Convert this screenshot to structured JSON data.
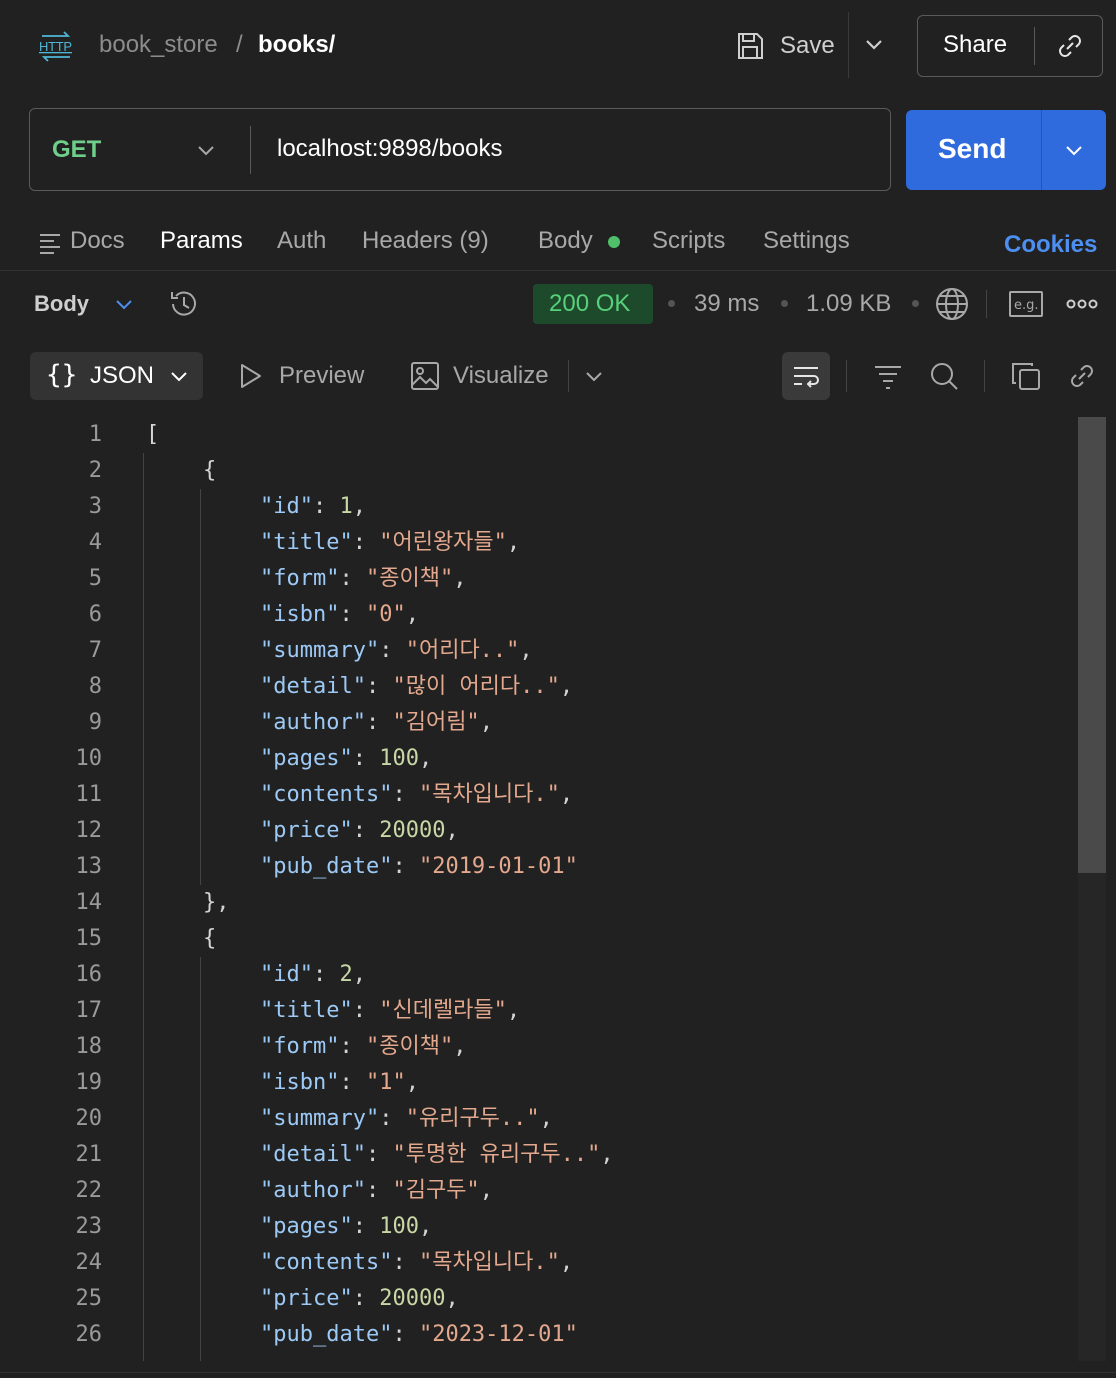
{
  "header": {
    "breadcrumb_parent": "book_store",
    "breadcrumb_separator": "/",
    "breadcrumb_current": "books/",
    "save_label": "Save",
    "share_label": "Share"
  },
  "request": {
    "method": "GET",
    "url": "localhost:9898/books",
    "send_label": "Send"
  },
  "tabs": {
    "docs": "Docs",
    "params": "Params",
    "auth": "Auth",
    "headers": "Headers (9)",
    "body": "Body",
    "scripts": "Scripts",
    "settings": "Settings",
    "cookies": "Cookies",
    "active": "Params"
  },
  "response": {
    "view_label": "Body",
    "status": "200 OK",
    "time": "39 ms",
    "size": "1.09 KB",
    "format_label": "JSON",
    "preview_label": "Preview",
    "visualize_label": "Visualize"
  },
  "colors": {
    "accent_blue": "#2f6bdc",
    "status_green": "#58d07a",
    "method_green": "#6fcf8a",
    "cookies_blue": "#4d8ff0"
  },
  "code_lines": [
    {
      "n": "1",
      "indent": 0,
      "tokens": [
        [
          "p",
          "["
        ]
      ]
    },
    {
      "n": "2",
      "indent": 1,
      "tokens": [
        [
          "p",
          "{"
        ]
      ]
    },
    {
      "n": "3",
      "indent": 2,
      "tokens": [
        [
          "k",
          "\"id\""
        ],
        [
          "p",
          ": "
        ],
        [
          "n",
          "1"
        ],
        [
          "p",
          ","
        ]
      ]
    },
    {
      "n": "4",
      "indent": 2,
      "tokens": [
        [
          "k",
          "\"title\""
        ],
        [
          "p",
          ": "
        ],
        [
          "s",
          "\"어린왕자들\""
        ],
        [
          "p",
          ","
        ]
      ]
    },
    {
      "n": "5",
      "indent": 2,
      "tokens": [
        [
          "k",
          "\"form\""
        ],
        [
          "p",
          ": "
        ],
        [
          "s",
          "\"종이책\""
        ],
        [
          "p",
          ","
        ]
      ]
    },
    {
      "n": "6",
      "indent": 2,
      "tokens": [
        [
          "k",
          "\"isbn\""
        ],
        [
          "p",
          ": "
        ],
        [
          "s",
          "\"0\""
        ],
        [
          "p",
          ","
        ]
      ]
    },
    {
      "n": "7",
      "indent": 2,
      "tokens": [
        [
          "k",
          "\"summary\""
        ],
        [
          "p",
          ": "
        ],
        [
          "s",
          "\"어리다..\""
        ],
        [
          "p",
          ","
        ]
      ]
    },
    {
      "n": "8",
      "indent": 2,
      "tokens": [
        [
          "k",
          "\"detail\""
        ],
        [
          "p",
          ": "
        ],
        [
          "s",
          "\"많이 어리다..\""
        ],
        [
          "p",
          ","
        ]
      ]
    },
    {
      "n": "9",
      "indent": 2,
      "tokens": [
        [
          "k",
          "\"author\""
        ],
        [
          "p",
          ": "
        ],
        [
          "s",
          "\"김어림\""
        ],
        [
          "p",
          ","
        ]
      ]
    },
    {
      "n": "10",
      "indent": 2,
      "tokens": [
        [
          "k",
          "\"pages\""
        ],
        [
          "p",
          ": "
        ],
        [
          "n",
          "100"
        ],
        [
          "p",
          ","
        ]
      ]
    },
    {
      "n": "11",
      "indent": 2,
      "tokens": [
        [
          "k",
          "\"contents\""
        ],
        [
          "p",
          ": "
        ],
        [
          "s",
          "\"목차입니다.\""
        ],
        [
          "p",
          ","
        ]
      ]
    },
    {
      "n": "12",
      "indent": 2,
      "tokens": [
        [
          "k",
          "\"price\""
        ],
        [
          "p",
          ": "
        ],
        [
          "n",
          "20000"
        ],
        [
          "p",
          ","
        ]
      ]
    },
    {
      "n": "13",
      "indent": 2,
      "tokens": [
        [
          "k",
          "\"pub_date\""
        ],
        [
          "p",
          ": "
        ],
        [
          "s",
          "\"2019-01-01\""
        ]
      ]
    },
    {
      "n": "14",
      "indent": 1,
      "tokens": [
        [
          "p",
          "},"
        ]
      ]
    },
    {
      "n": "15",
      "indent": 1,
      "tokens": [
        [
          "p",
          "{"
        ]
      ]
    },
    {
      "n": "16",
      "indent": 2,
      "tokens": [
        [
          "k",
          "\"id\""
        ],
        [
          "p",
          ": "
        ],
        [
          "n",
          "2"
        ],
        [
          "p",
          ","
        ]
      ]
    },
    {
      "n": "17",
      "indent": 2,
      "tokens": [
        [
          "k",
          "\"title\""
        ],
        [
          "p",
          ": "
        ],
        [
          "s",
          "\"신데렐라들\""
        ],
        [
          "p",
          ","
        ]
      ]
    },
    {
      "n": "18",
      "indent": 2,
      "tokens": [
        [
          "k",
          "\"form\""
        ],
        [
          "p",
          ": "
        ],
        [
          "s",
          "\"종이책\""
        ],
        [
          "p",
          ","
        ]
      ]
    },
    {
      "n": "19",
      "indent": 2,
      "tokens": [
        [
          "k",
          "\"isbn\""
        ],
        [
          "p",
          ": "
        ],
        [
          "s",
          "\"1\""
        ],
        [
          "p",
          ","
        ]
      ]
    },
    {
      "n": "20",
      "indent": 2,
      "tokens": [
        [
          "k",
          "\"summary\""
        ],
        [
          "p",
          ": "
        ],
        [
          "s",
          "\"유리구두..\""
        ],
        [
          "p",
          ","
        ]
      ]
    },
    {
      "n": "21",
      "indent": 2,
      "tokens": [
        [
          "k",
          "\"detail\""
        ],
        [
          "p",
          ": "
        ],
        [
          "s",
          "\"투명한 유리구두..\""
        ],
        [
          "p",
          ","
        ]
      ]
    },
    {
      "n": "22",
      "indent": 2,
      "tokens": [
        [
          "k",
          "\"author\""
        ],
        [
          "p",
          ": "
        ],
        [
          "s",
          "\"김구두\""
        ],
        [
          "p",
          ","
        ]
      ]
    },
    {
      "n": "23",
      "indent": 2,
      "tokens": [
        [
          "k",
          "\"pages\""
        ],
        [
          "p",
          ": "
        ],
        [
          "n",
          "100"
        ],
        [
          "p",
          ","
        ]
      ]
    },
    {
      "n": "24",
      "indent": 2,
      "tokens": [
        [
          "k",
          "\"contents\""
        ],
        [
          "p",
          ": "
        ],
        [
          "s",
          "\"목차입니다.\""
        ],
        [
          "p",
          ","
        ]
      ]
    },
    {
      "n": "25",
      "indent": 2,
      "tokens": [
        [
          "k",
          "\"price\""
        ],
        [
          "p",
          ": "
        ],
        [
          "n",
          "20000"
        ],
        [
          "p",
          ","
        ]
      ]
    },
    {
      "n": "26",
      "indent": 2,
      "tokens": [
        [
          "k",
          "\"pub_date\""
        ],
        [
          "p",
          ": "
        ],
        [
          "s",
          "\"2023-12-01\""
        ]
      ]
    }
  ]
}
